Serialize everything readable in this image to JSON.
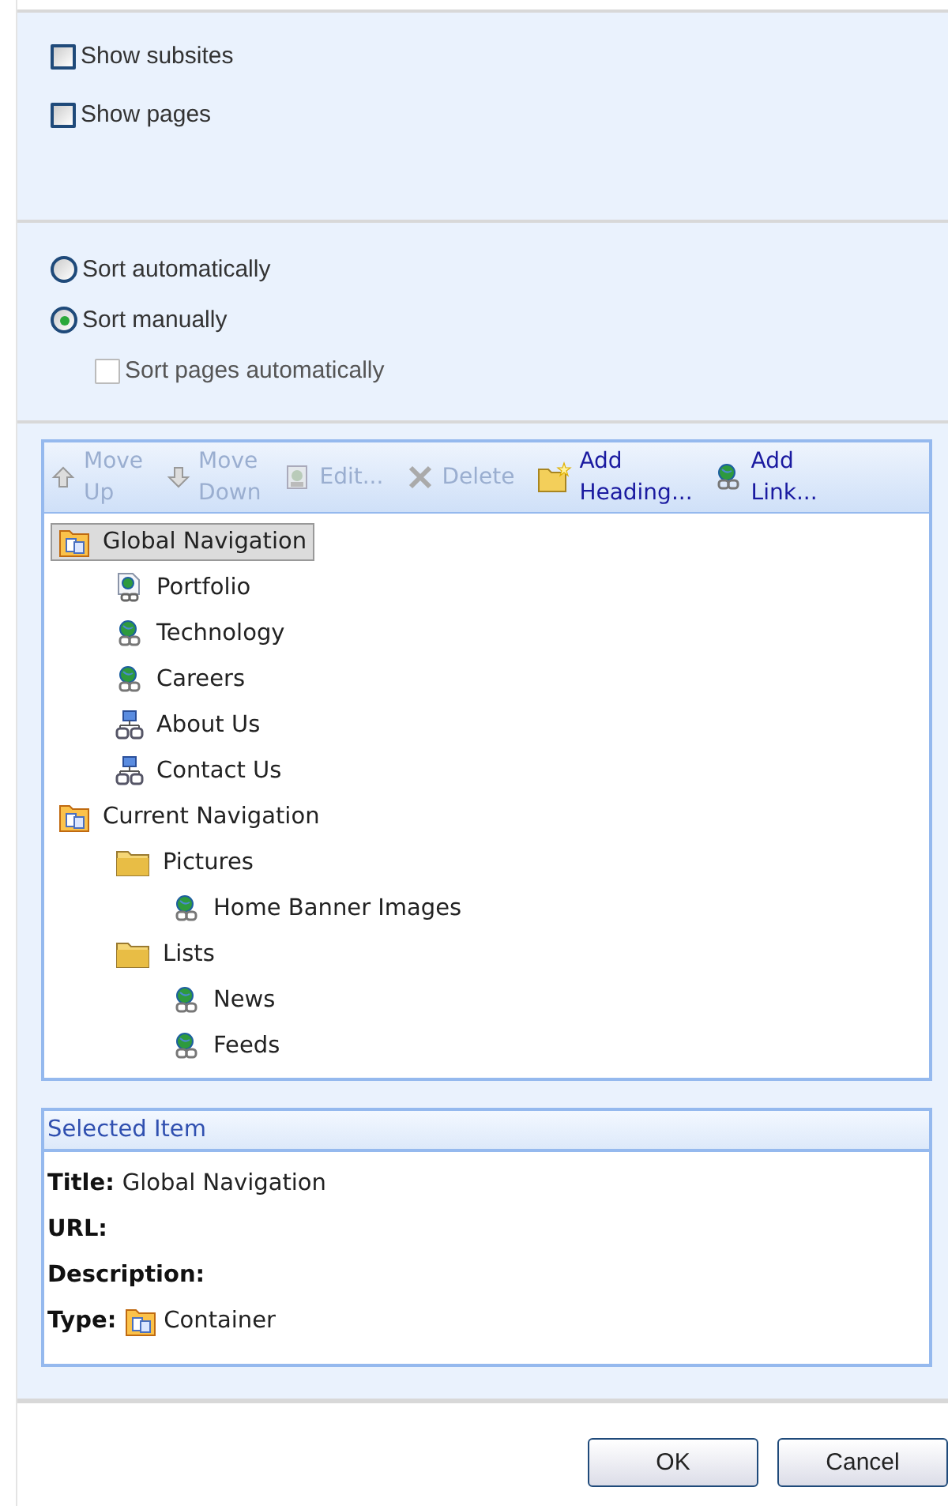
{
  "options": [
    {
      "label": "Show subsites",
      "checked": false
    },
    {
      "label": "Show pages",
      "checked": false
    }
  ],
  "sorting": [
    {
      "label": "Sort automatically",
      "selected": false
    },
    {
      "label": "Sort manually",
      "selected": true
    }
  ],
  "sort_pages": {
    "label": "Sort pages automatically",
    "checked": false,
    "disabled": true
  },
  "toolbar": [
    {
      "label": "Move Up",
      "kind": "up",
      "disabled": true
    },
    {
      "label": "Move Down",
      "kind": "down",
      "disabled": true
    },
    {
      "label": "Edit...",
      "kind": "edit",
      "disabled": true
    },
    {
      "label": "Delete",
      "kind": "delete",
      "disabled": true
    },
    {
      "label": "Add Heading...",
      "kind": "heading",
      "disabled": false
    },
    {
      "label": "Add Link...",
      "kind": "link",
      "disabled": false
    }
  ],
  "tree": [
    {
      "label": "Global Navigation",
      "kind": "container",
      "selected": true,
      "children": [
        {
          "label": "Portfolio",
          "kind": "page",
          "selected": false
        },
        {
          "label": "Technology",
          "kind": "link",
          "selected": false
        },
        {
          "label": "Careers",
          "kind": "link",
          "selected": false
        },
        {
          "label": "About Us",
          "kind": "site",
          "selected": false
        },
        {
          "label": "Contact Us",
          "kind": "site",
          "selected": false
        }
      ]
    },
    {
      "label": "Current Navigation",
      "kind": "container",
      "selected": false,
      "children": [
        {
          "label": "Pictures",
          "kind": "folder",
          "selected": false,
          "children": [
            {
              "label": "Home Banner Images",
              "kind": "link",
              "selected": false
            }
          ]
        },
        {
          "label": "Lists",
          "kind": "folder",
          "selected": false,
          "children": [
            {
              "label": "News",
              "kind": "link",
              "selected": false
            },
            {
              "label": "Feeds",
              "kind": "link",
              "selected": false
            }
          ]
        }
      ]
    }
  ],
  "selected_item": {
    "title": "Selected Item",
    "fields": [
      {
        "label": "Title:",
        "value": "Global Navigation"
      },
      {
        "label": "URL:"
      },
      {
        "label": "Description:"
      },
      {
        "label": "Type:",
        "value": "Container",
        "kind": "container"
      }
    ]
  },
  "buttons": [
    "OK",
    "Cancel"
  ]
}
